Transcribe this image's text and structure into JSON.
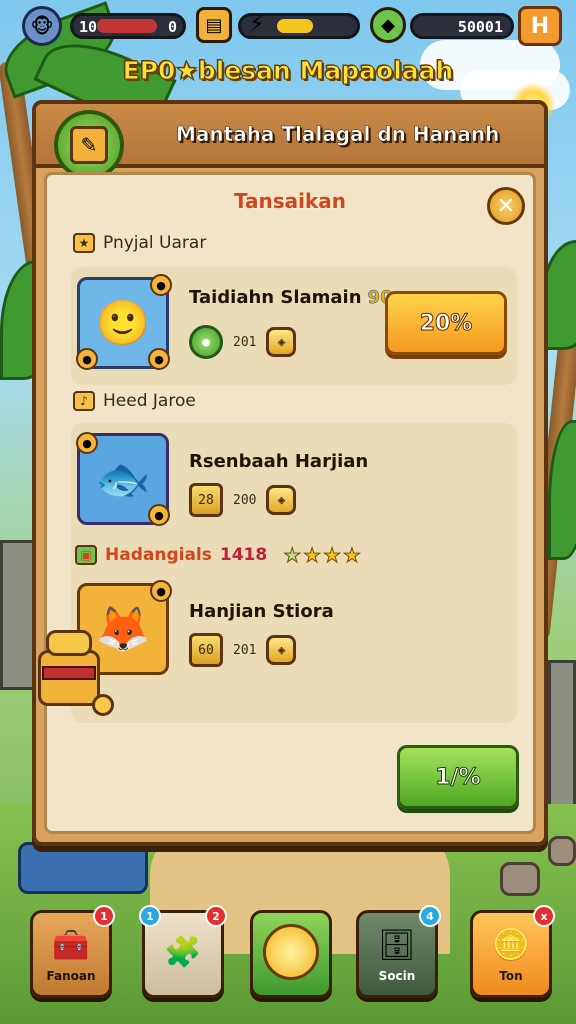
{
  "hud": {
    "level_value": "10",
    "xp_value": "0",
    "energy_fill_percent": 45,
    "coin_value": "50001",
    "menu_glyph": "H"
  },
  "event_banner": "EP0★blesan Mapaolaah",
  "panel": {
    "title": "Mantaha Tlalagal dn Hananh",
    "tab_title": "Tansaikan",
    "close_glyph": "✕"
  },
  "sections": [
    {
      "label": "Pnyjal Uarar",
      "items": [
        {
          "name": "Taidiahn Slamain",
          "badge": "90",
          "stat_gem": "",
          "stat_value": "201",
          "button_label": "20%"
        }
      ]
    },
    {
      "label": "Heed Jaroe",
      "items": [
        {
          "name": "Rsenbaah Harjian",
          "badge": "",
          "stat_gem": "28",
          "stat_value": "200"
        }
      ]
    },
    {
      "label": "Hadangials",
      "label_extra": "1418",
      "rating": 4,
      "items": [
        {
          "name": "Hanjian Stiora",
          "badge": "",
          "stat_gem": "60",
          "stat_value": "201"
        }
      ]
    }
  ],
  "footer": {
    "button_label": "1/%"
  },
  "nav": [
    {
      "label": "Fanoan",
      "badge": "1",
      "icon": "chest-icon"
    },
    {
      "label": "",
      "badge": "2",
      "icon": "puzzle-icon",
      "top_badge": "1"
    },
    {
      "label": "",
      "badge": "",
      "icon": "gold-coin-icon"
    },
    {
      "label": "Socin",
      "badge": "4",
      "icon": "shop-icon"
    },
    {
      "label": "Ton",
      "badge": "x",
      "icon": "coin-stack-icon"
    }
  ],
  "colors": {
    "accent_orange": "#f59a1e",
    "accent_green": "#4ea824",
    "panel_wood": "#d9a35f",
    "title_red": "#d2461e"
  }
}
